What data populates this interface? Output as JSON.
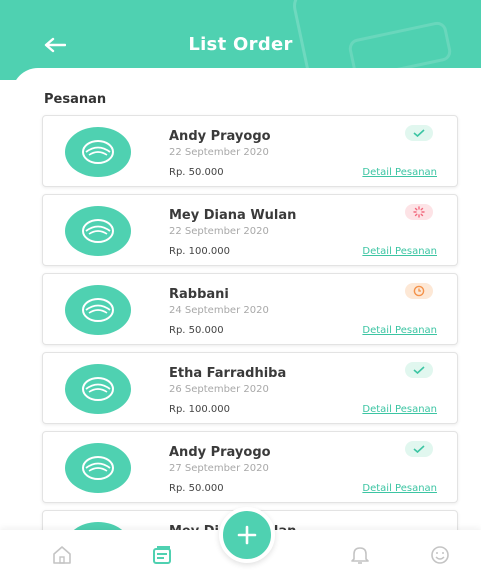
{
  "header": {
    "title": "List Order",
    "back_icon": "arrow-left-icon"
  },
  "section": {
    "label": "Pesanan"
  },
  "orders": [
    {
      "name": "Andy Prayogo",
      "date": "22 September 2020",
      "price": "Rp. 50.000",
      "link": "Detail Pesanan",
      "status": "check-icon"
    },
    {
      "name": "Mey Diana Wulan",
      "date": "22 September 2020",
      "price": "Rp. 100.000",
      "link": "Detail Pesanan",
      "status": "loading-icon"
    },
    {
      "name": "Rabbani",
      "date": "24 September 2020",
      "price": "Rp. 50.000",
      "link": "Detail Pesanan",
      "status": "clock-icon"
    },
    {
      "name": "Etha Farradhiba",
      "date": "26 September 2020",
      "price": "Rp. 100.000",
      "link": "Detail Pesanan",
      "status": "check-icon"
    },
    {
      "name": "Andy Prayogo",
      "date": "27 September 2020",
      "price": "Rp. 50.000",
      "link": "Detail Pesanan",
      "status": "check-icon"
    },
    {
      "name": "Mey Diana Wulan",
      "date": "",
      "price": "",
      "link": "",
      "status": ""
    }
  ],
  "colors": {
    "accent": "#4fd1b1",
    "link": "#3cc5a3",
    "done_bg": "#e1f7ef",
    "proc_bg": "#fde3e6",
    "wait_bg": "#fde8d6"
  },
  "nav": {
    "items": [
      "home-icon",
      "list-icon",
      "bell-icon",
      "smile-icon"
    ],
    "fab_icon": "plus-icon"
  }
}
